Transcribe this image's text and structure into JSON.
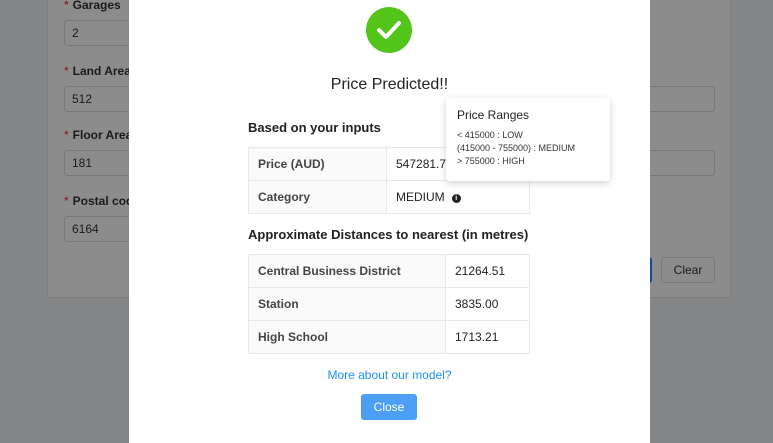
{
  "background_form": {
    "garages": {
      "label": "Garages",
      "value": "2"
    },
    "land_area": {
      "label": "Land Area",
      "value": "512"
    },
    "floor_area": {
      "label": "Floor Area",
      "value": "181"
    },
    "postal_code": {
      "label": "Postal cod",
      "value": "6164"
    },
    "clear_label": "Clear"
  },
  "modal": {
    "title": "Price Predicted!!",
    "inputs_section_title": "Based on your inputs",
    "inputs_rows": [
      {
        "key": "Price (AUD)",
        "value": "547281.72"
      },
      {
        "key": "Category",
        "value": "MEDIUM"
      }
    ],
    "distances_section_title": "Approximate Distances to nearest (in metres)",
    "distance_rows": [
      {
        "key": "Central Business District",
        "value": "21264.51"
      },
      {
        "key": "Station",
        "value": "3835.00"
      },
      {
        "key": "High School",
        "value": "1713.21"
      }
    ],
    "more_link": "More about our model?",
    "close_label": "Close"
  },
  "tooltip": {
    "title": "Price Ranges",
    "lines": [
      "< 415000 : LOW",
      "(415000 - 755000) : MEDIUM",
      "> 755000 : HIGH"
    ]
  },
  "colors": {
    "success": "#52c41a",
    "primary": "#1890ff",
    "close_button": "#4d9ff5"
  }
}
